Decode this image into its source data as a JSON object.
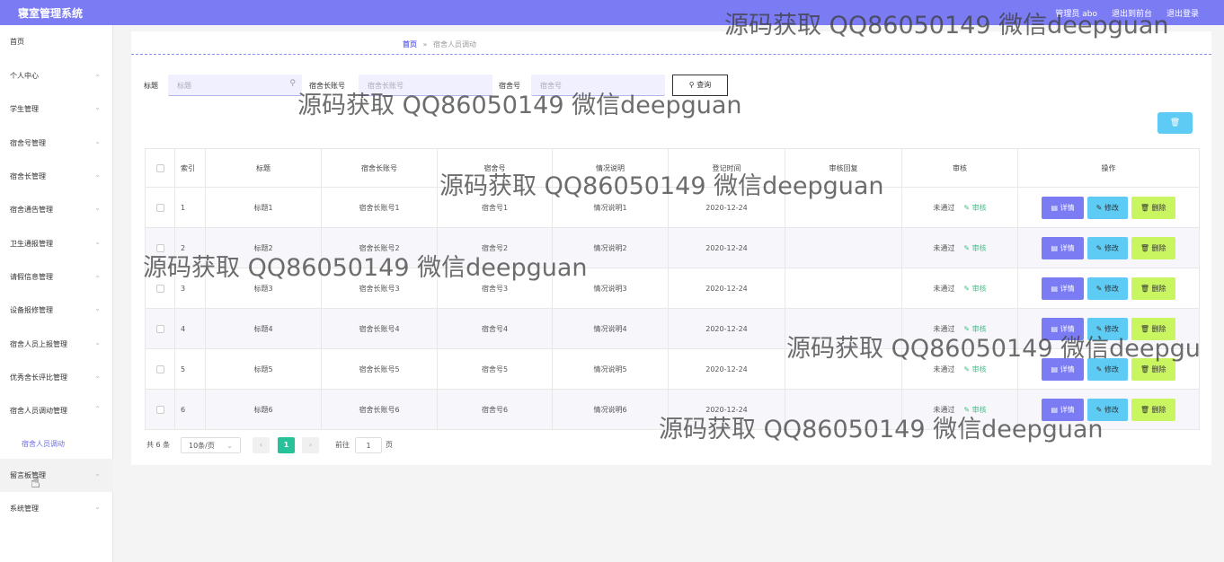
{
  "app": {
    "title": "寝室管理系统"
  },
  "topbar": {
    "user": "管理员 abo",
    "back_front": "退出到前台",
    "logout": "退出登录"
  },
  "sidebar": {
    "items": [
      {
        "label": "首页",
        "has_arrow": false
      },
      {
        "label": "个人中心",
        "has_arrow": true
      },
      {
        "label": "学生管理",
        "has_arrow": true
      },
      {
        "label": "宿舍号管理",
        "has_arrow": true
      },
      {
        "label": "宿舍长管理",
        "has_arrow": true
      },
      {
        "label": "宿舍通告管理",
        "has_arrow": true
      },
      {
        "label": "卫生通报管理",
        "has_arrow": true
      },
      {
        "label": "请假信息管理",
        "has_arrow": true
      },
      {
        "label": "设备报修管理",
        "has_arrow": true
      },
      {
        "label": "宿舍人员上报管理",
        "has_arrow": true
      },
      {
        "label": "优秀舍长评比管理",
        "has_arrow": true
      },
      {
        "label": "宿舍人员调动管理",
        "has_arrow": true,
        "expanded": true
      },
      {
        "label": "宿舍人员调动",
        "sub": true
      },
      {
        "label": "留言板管理",
        "has_arrow": true
      },
      {
        "label": "系统管理",
        "has_arrow": true
      }
    ]
  },
  "breadcrumb": {
    "home": "首页",
    "separator": "»",
    "current": "宿舍人员调动"
  },
  "search": {
    "title_label": "标题",
    "title_placeholder": "标题",
    "account_label": "宿舍长账号",
    "account_placeholder": "宿舍长账号",
    "room_label": "宿舍号",
    "room_placeholder": "宿舍号",
    "query_button": "查询"
  },
  "table": {
    "headers": [
      "索引",
      "标题",
      "宿舍长账号",
      "宿舍号",
      "情况说明",
      "登记时间",
      "审核回复",
      "审核",
      "操作"
    ],
    "rows": [
      {
        "index": "1",
        "title": "标题1",
        "account": "宿舍长账号1",
        "room": "宿舍号1",
        "desc": "情况说明1",
        "date": "2020-12-24",
        "reply": "",
        "status": "未通过",
        "audit": "审核"
      },
      {
        "index": "2",
        "title": "标题2",
        "account": "宿舍长账号2",
        "room": "宿舍号2",
        "desc": "情况说明2",
        "date": "2020-12-24",
        "reply": "",
        "status": "未通过",
        "audit": "审核"
      },
      {
        "index": "3",
        "title": "标题3",
        "account": "宿舍长账号3",
        "room": "宿舍号3",
        "desc": "情况说明3",
        "date": "2020-12-24",
        "reply": "",
        "status": "未通过",
        "audit": "审核"
      },
      {
        "index": "4",
        "title": "标题4",
        "account": "宿舍长账号4",
        "room": "宿舍号4",
        "desc": "情况说明4",
        "date": "2020-12-24",
        "reply": "",
        "status": "未通过",
        "audit": "审核"
      },
      {
        "index": "5",
        "title": "标题5",
        "account": "宿舍长账号5",
        "room": "宿舍号5",
        "desc": "情况说明5",
        "date": "2020-12-24",
        "reply": "",
        "status": "未通过",
        "audit": "审核"
      },
      {
        "index": "6",
        "title": "标题6",
        "account": "宿舍长账号6",
        "room": "宿舍号6",
        "desc": "情况说明6",
        "date": "2020-12-24",
        "reply": "",
        "status": "未通过",
        "audit": "审核"
      }
    ],
    "actions": {
      "detail": "详情",
      "edit": "修改",
      "delete": "删除"
    }
  },
  "pagination": {
    "total": "共 6 条",
    "page_size": "10条/页",
    "current_page": "1",
    "goto_label": "前往",
    "goto_value": "1",
    "page_suffix": "页"
  },
  "watermarks": {
    "w1": "源码获取 QQ86050149 微信deepguan",
    "w2": "源码获取 QQ86050149 微信deepguan",
    "w3": "源码获取 QQ86050149 微信deepguan",
    "w4": "源码获取 QQ86050149 微信deepguan",
    "w5": "源码获取 QQ86050149 微信deepgu",
    "w6": "源码获取 QQ86050149 微信deepguan"
  },
  "colors": {
    "primary": "#7b7cf4",
    "info": "#5ecbf5",
    "danger_lime": "#c9f561",
    "page_active": "#27c29a"
  }
}
